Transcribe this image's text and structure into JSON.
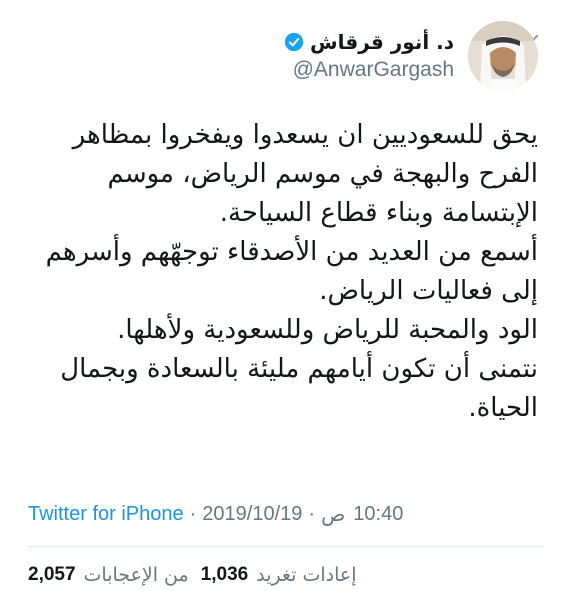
{
  "tweet": {
    "author": {
      "display_name": "د. أنور قرقاش",
      "handle": "@AnwarGargash",
      "verified": true
    },
    "body": [
      "يحق للسعوديين ان يسعدوا ويفخروا بمظاهر الفرح والبهجة في موسم الرياض، موسم الإبتسامة وبناء قطاع السياحة.",
      "أسمع من العديد من الأصدقاء توجهّهم وأسرهم إلى فعاليات الرياض.",
      "الود والمحبة للرياض وللسعودية ولأهلها.",
      "نتمنى أن تكون أيامهم مليئة بالسعادة وبجمال الحياة."
    ],
    "source": "Twitter for iPhone",
    "date": "2019/10/19",
    "time": "10:40",
    "ampm": "ص",
    "separator": "·",
    "stats": {
      "likes_count": "2,057",
      "likes_label": "من الإعجابات",
      "retweets_count": "1,036",
      "retweets_label": "إعادات تغريد"
    }
  },
  "colors": {
    "accent": "#1b95e0",
    "secondary_text": "#657786",
    "primary_text": "#14171a",
    "verified_badge": "#1da1f2"
  },
  "icons": {
    "more": "chevron-down-icon",
    "verified": "verified-badge-icon"
  }
}
